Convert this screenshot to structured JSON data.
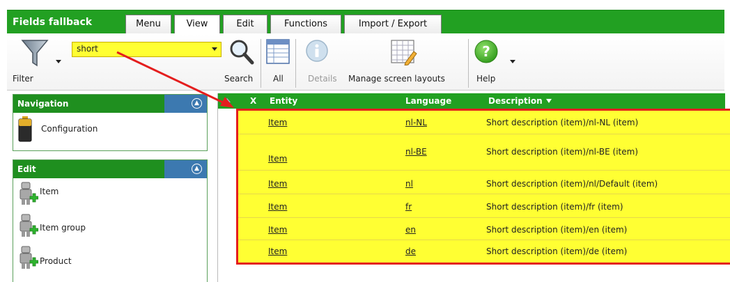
{
  "app": {
    "title": "Fields fallback"
  },
  "tabs": [
    {
      "label": "Menu",
      "active": false
    },
    {
      "label": "View",
      "active": true
    },
    {
      "label": "Edit",
      "active": false
    },
    {
      "label": "Functions",
      "active": false
    },
    {
      "label": "Import / Export",
      "active": false
    }
  ],
  "toolbar": {
    "filter_label": "Filter",
    "filter_value": "short",
    "search_label": "Search",
    "all_label": "All",
    "details_label": "Details",
    "manage_label": "Manage screen layouts",
    "help_label": "Help"
  },
  "navigation": {
    "title": "Navigation",
    "items": [
      {
        "label": "Configuration"
      }
    ]
  },
  "edit_panel": {
    "title": "Edit",
    "items": [
      {
        "label": "Item"
      },
      {
        "label": "Item group"
      },
      {
        "label": "Product"
      }
    ]
  },
  "grid": {
    "columns": {
      "x": "X",
      "entity": "Entity",
      "language": "Language",
      "description": "Description"
    },
    "rows": [
      {
        "entity": "Item",
        "language": "nl-NL",
        "description": "Short description (item)/nl-NL (item)"
      },
      {
        "entity": "Item",
        "language": "nl-BE",
        "description": "Short description (item)/nl-BE (item)"
      },
      {
        "entity": "Item",
        "language": "nl",
        "description": "Short description (item)/nl/Default (item)"
      },
      {
        "entity": "Item",
        "language": "fr",
        "description": "Short description (item)/fr (item)"
      },
      {
        "entity": "Item",
        "language": "en",
        "description": "Short description (item)/en (item)"
      },
      {
        "entity": "Item",
        "language": "de",
        "description": "Short description (item)/de (item)"
      }
    ]
  },
  "colors": {
    "brand_green": "#22a022",
    "panel_blue": "#3c79b0",
    "highlight_yellow": "#ffff33",
    "annotation_red": "#e41e1e"
  }
}
